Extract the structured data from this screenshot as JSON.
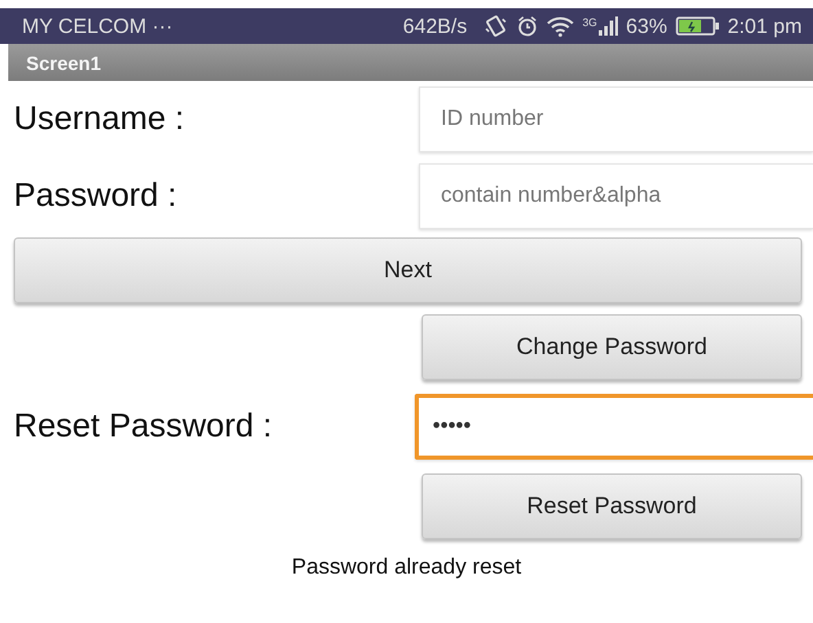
{
  "status_bar": {
    "carrier": "MY CELCOM ···",
    "speed": "642B/s",
    "network": "3G",
    "battery": "63%",
    "time": "2:01 pm"
  },
  "title_bar": {
    "title": "Screen1"
  },
  "form": [
    {
      "kind": "field",
      "label": "Username :",
      "placeholder": "ID number",
      "focused": false
    },
    {
      "kind": "field",
      "label": "Password :",
      "placeholder": "contain number&alpha",
      "focused": false
    },
    {
      "kind": "wide_button",
      "label": "Next"
    },
    {
      "kind": "button",
      "label": "Change Password"
    },
    {
      "kind": "field",
      "label": "Reset Password :",
      "value": "•••••",
      "focused": true
    },
    {
      "kind": "button",
      "label": "Reset Password"
    },
    {
      "kind": "message",
      "text": "Password already reset"
    }
  ]
}
